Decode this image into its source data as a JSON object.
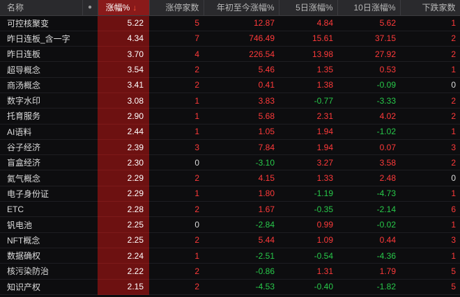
{
  "header": {
    "name": "名称",
    "dot": "●",
    "change_pct": "涨幅%",
    "sort_arrow": "↓",
    "limit_up_count": "涨停家数",
    "ytd_pct": "年初至今涨幅%",
    "pct_5d": "5日涨幅%",
    "pct_10d": "10日涨幅%",
    "decliners": "下跌家数"
  },
  "colors": {
    "up": "#ff3a3a",
    "down": "#28c94a",
    "highlight_col": "#6d1111"
  },
  "rows": [
    {
      "name": "可控核聚变",
      "chg": "5.22",
      "limit": "5",
      "ytd": "12.87",
      "d5": "4.84",
      "d10": "5.62",
      "dn": "1"
    },
    {
      "name": "昨日连板_含一字",
      "chg": "4.34",
      "limit": "7",
      "ytd": "746.49",
      "d5": "15.61",
      "d10": "37.15",
      "dn": "2"
    },
    {
      "name": "昨日连板",
      "chg": "3.70",
      "limit": "4",
      "ytd": "226.54",
      "d5": "13.98",
      "d10": "27.92",
      "dn": "2"
    },
    {
      "name": "超导概念",
      "chg": "3.54",
      "limit": "2",
      "ytd": "5.46",
      "d5": "1.35",
      "d10": "0.53",
      "dn": "1"
    },
    {
      "name": "商汤概念",
      "chg": "3.41",
      "limit": "2",
      "ytd": "0.41",
      "d5": "1.38",
      "d10": "-0.09",
      "dn": "0"
    },
    {
      "name": "数字水印",
      "chg": "3.08",
      "limit": "1",
      "ytd": "3.83",
      "d5": "-0.77",
      "d10": "-3.33",
      "dn": "2"
    },
    {
      "name": "托育服务",
      "chg": "2.90",
      "limit": "1",
      "ytd": "5.68",
      "d5": "2.31",
      "d10": "4.02",
      "dn": "2"
    },
    {
      "name": "AI语料",
      "chg": "2.44",
      "limit": "1",
      "ytd": "1.05",
      "d5": "1.94",
      "d10": "-1.02",
      "dn": "1"
    },
    {
      "name": "谷子经济",
      "chg": "2.39",
      "limit": "3",
      "ytd": "7.84",
      "d5": "1.94",
      "d10": "0.07",
      "dn": "3"
    },
    {
      "name": "盲盒经济",
      "chg": "2.30",
      "limit": "0",
      "ytd": "-3.10",
      "d5": "3.27",
      "d10": "3.58",
      "dn": "2"
    },
    {
      "name": "氦气概念",
      "chg": "2.29",
      "limit": "2",
      "ytd": "4.15",
      "d5": "1.33",
      "d10": "2.48",
      "dn": "0"
    },
    {
      "name": "电子身份证",
      "chg": "2.29",
      "limit": "1",
      "ytd": "1.80",
      "d5": "-1.19",
      "d10": "-4.73",
      "dn": "1"
    },
    {
      "name": "ETC",
      "chg": "2.28",
      "limit": "2",
      "ytd": "1.67",
      "d5": "-0.35",
      "d10": "-2.14",
      "dn": "6"
    },
    {
      "name": "钒电池",
      "chg": "2.25",
      "limit": "0",
      "ytd": "-2.84",
      "d5": "0.99",
      "d10": "-0.02",
      "dn": "1"
    },
    {
      "name": "NFT概念",
      "chg": "2.25",
      "limit": "2",
      "ytd": "5.44",
      "d5": "1.09",
      "d10": "0.44",
      "dn": "3"
    },
    {
      "name": "数据确权",
      "chg": "2.24",
      "limit": "1",
      "ytd": "-2.51",
      "d5": "-0.54",
      "d10": "-4.36",
      "dn": "1"
    },
    {
      "name": "核污染防治",
      "chg": "2.22",
      "limit": "2",
      "ytd": "-0.86",
      "d5": "1.31",
      "d10": "1.79",
      "dn": "5"
    },
    {
      "name": "知识产权",
      "chg": "2.15",
      "limit": "2",
      "ytd": "-4.53",
      "d5": "-0.40",
      "d10": "-1.82",
      "dn": "5"
    }
  ]
}
